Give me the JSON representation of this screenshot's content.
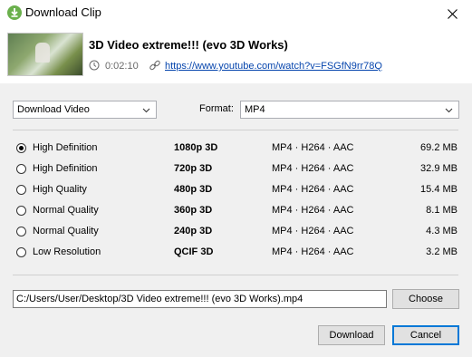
{
  "window": {
    "title": "Download Clip"
  },
  "video": {
    "title": "3D Video extreme!!! (evo 3D Works)",
    "duration": "0:02:10",
    "url": "https://www.youtube.com/watch?v=FSGfN9rr78Q"
  },
  "download_type": {
    "selected": "Download Video"
  },
  "format": {
    "label": "Format:",
    "selected": "MP4"
  },
  "options": [
    {
      "quality": "High Definition",
      "resolution": "1080p  3D",
      "codec": "MP4 · H264 · AAC",
      "size": "69.2 MB",
      "checked": true
    },
    {
      "quality": "High Definition",
      "resolution": "720p  3D",
      "codec": "MP4 · H264 · AAC",
      "size": "32.9 MB",
      "checked": false
    },
    {
      "quality": "High Quality",
      "resolution": "480p  3D",
      "codec": "MP4 · H264 · AAC",
      "size": "15.4 MB",
      "checked": false
    },
    {
      "quality": "Normal Quality",
      "resolution": "360p  3D",
      "codec": "MP4 · H264 · AAC",
      "size": "8.1 MB",
      "checked": false
    },
    {
      "quality": "Normal Quality",
      "resolution": "240p  3D",
      "codec": "MP4 · H264 · AAC",
      "size": "4.3 MB",
      "checked": false
    },
    {
      "quality": "Low Resolution",
      "resolution": "QCIF  3D",
      "codec": "MP4 · H264 · AAC",
      "size": "3.2 MB",
      "checked": false
    }
  ],
  "save_path": {
    "value": "C:/Users/User/Desktop/3D Video extreme!!! (evo 3D Works).mp4"
  },
  "buttons": {
    "choose": "Choose",
    "download": "Download",
    "cancel": "Cancel"
  },
  "colors": {
    "link": "#0645ad",
    "primary_border": "#0078d7",
    "app_icon": "#6ab04c"
  },
  "icons": {
    "app": "download-icon",
    "close": "close-icon",
    "duration": "clock-icon",
    "url": "link-icon"
  }
}
